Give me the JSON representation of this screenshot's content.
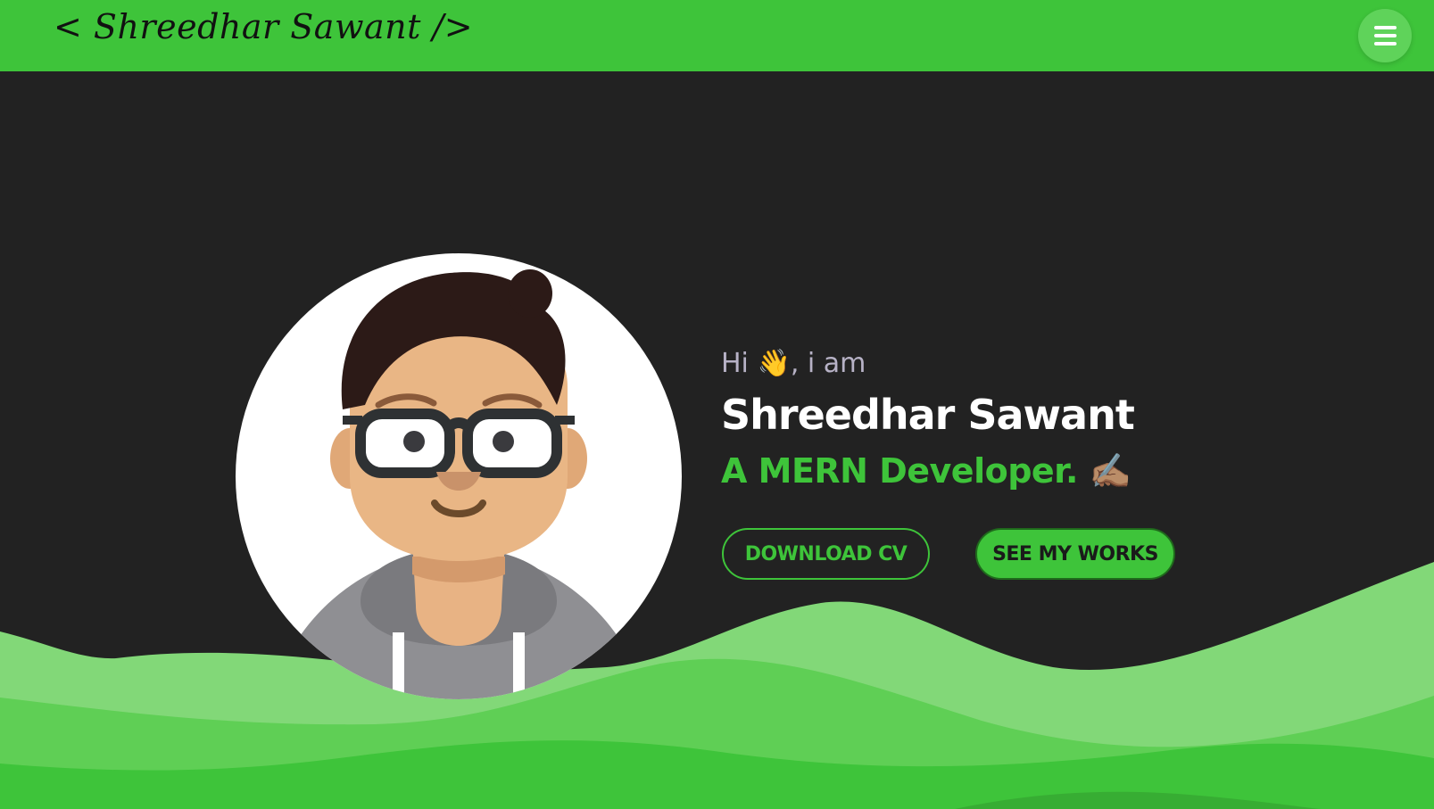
{
  "navbar": {
    "brand": "< Shreedhar Sawant />",
    "menu_icon": "hamburger-icon"
  },
  "hero": {
    "greeting_prefix": "Hi",
    "greeting_emoji": "👋",
    "greeting_suffix": ", i am",
    "name": "Shreedhar Sawant",
    "role": "A MERN Developer.",
    "role_emoji": "✍🏽",
    "download_button": "DOWNLOAD CV",
    "works_button": "SEE MY WORKS",
    "avatar_icon": "developer-avatar-illustration"
  },
  "colors": {
    "accent": "#3ec43a",
    "background": "#222222",
    "greeting": "#b7b2c6",
    "wave_light": "#82d878",
    "wave_mid": "#5fcf55",
    "wave_dark": "#3ec43a"
  }
}
